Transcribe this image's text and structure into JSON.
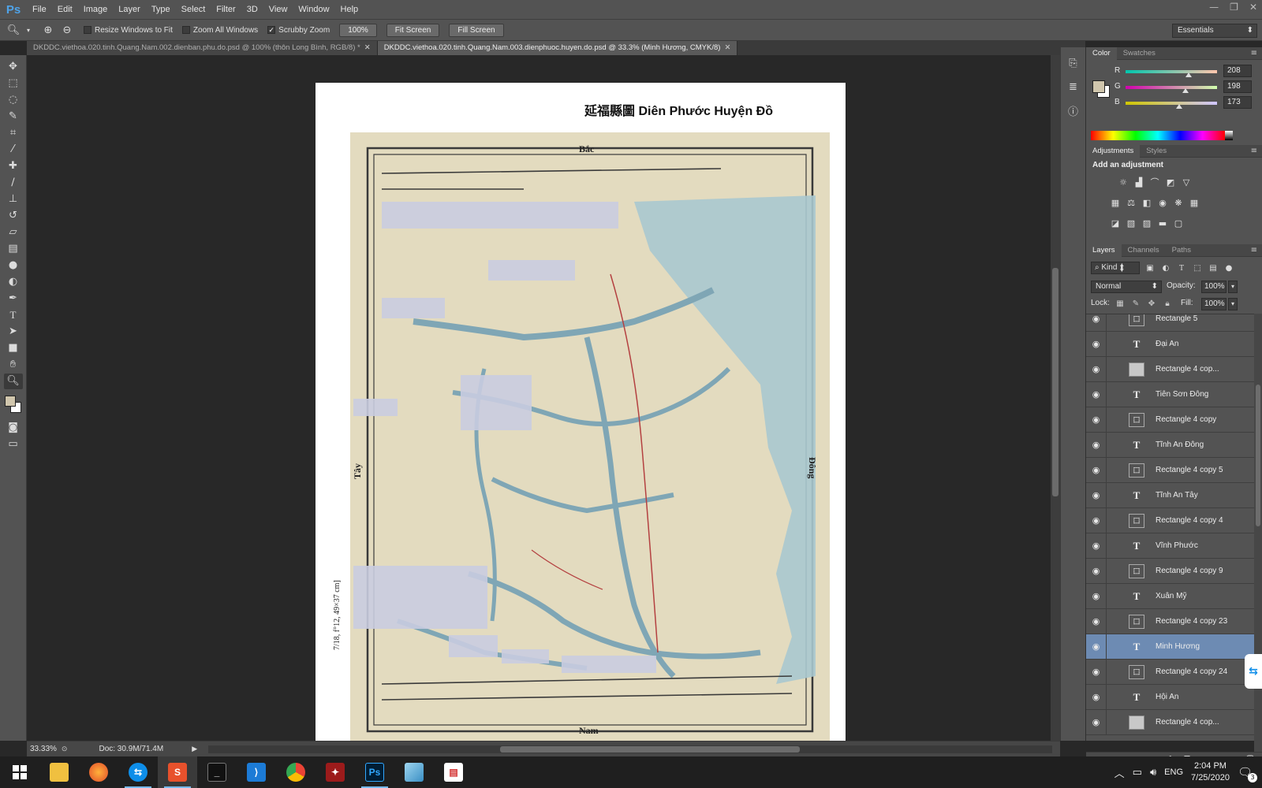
{
  "app": {
    "logo": "Ps",
    "menu": [
      "File",
      "Edit",
      "Image",
      "Layer",
      "Type",
      "Select",
      "Filter",
      "3D",
      "View",
      "Window",
      "Help"
    ],
    "window_controls": [
      "—",
      "❐",
      "✕"
    ]
  },
  "options_bar": {
    "tool_icon": "zoom-icon",
    "resize_windows_label": "Resize Windows to Fit",
    "resize_windows_checked": false,
    "zoom_all_label": "Zoom All Windows",
    "zoom_all_checked": false,
    "scrubby_label": "Scrubby Zoom",
    "scrubby_checked": true,
    "btn_100": "100%",
    "btn_fit": "Fit Screen",
    "btn_fill": "Fill Screen",
    "workspace": "Essentials"
  },
  "tabs": [
    {
      "label": "DKDDC.viethoa.020.tinh.Quang.Nam.002.dienban.phu.do.psd @ 100% (thôn Long Bình, RGB/8) *",
      "close": "✕",
      "active": false
    },
    {
      "label": "DKDDC.viethoa.020.tinh.Quang.Nam.003.dienphuoc.huyen.do.psd @ 33.3% (Minh Hương, CMYK/8)",
      "close": "✕",
      "active": true
    }
  ],
  "document": {
    "title": "延福縣圖  Diên Phước Huyện Đồ",
    "side_label": "7/18, f°12, 49×37 cm]",
    "map_labels": {
      "north": "Bắc",
      "south": "Nam",
      "west": "Tây",
      "east": "Đông"
    }
  },
  "color_panel": {
    "tabs": [
      "Color",
      "Swatches"
    ],
    "fg": "#d0c6ad",
    "r_label": "R",
    "r_value": "208",
    "g_label": "G",
    "g_value": "198",
    "b_label": "B",
    "b_value": "173"
  },
  "adjustments_panel": {
    "tabs": [
      "Adjustments",
      "Styles"
    ],
    "title": "Add an adjustment"
  },
  "layers_panel": {
    "tabs": [
      "Layers",
      "Channels",
      "Paths"
    ],
    "filter_kind": "Kind",
    "blend_mode": "Normal",
    "opacity_label": "Opacity:",
    "opacity_value": "100%",
    "lock_label": "Lock:",
    "fill_label": "Fill:",
    "fill_value": "100%",
    "layers": [
      {
        "name": "Rectangle 5",
        "kind": "shape",
        "selected": false
      },
      {
        "name": "Đại An",
        "kind": "text",
        "selected": false
      },
      {
        "name": "Rectangle 4 cop...",
        "kind": "smart",
        "selected": false
      },
      {
        "name": "Tiên Sơn Đông",
        "kind": "text",
        "selected": false
      },
      {
        "name": "Rectangle 4 copy",
        "kind": "shape",
        "selected": false
      },
      {
        "name": "Tĩnh An Đông",
        "kind": "text",
        "selected": false
      },
      {
        "name": "Rectangle 4 copy 5",
        "kind": "shape",
        "selected": false
      },
      {
        "name": "Tĩnh An Tây",
        "kind": "text",
        "selected": false
      },
      {
        "name": "Rectangle 4 copy 4",
        "kind": "shape",
        "selected": false
      },
      {
        "name": "Vĩnh Phước",
        "kind": "text",
        "selected": false
      },
      {
        "name": "Rectangle 4 copy 9",
        "kind": "shape",
        "selected": false
      },
      {
        "name": "Xuân Mỹ",
        "kind": "text",
        "selected": false
      },
      {
        "name": "Rectangle 4 copy 23",
        "kind": "shape",
        "selected": false
      },
      {
        "name": "Minh Hương",
        "kind": "text",
        "selected": true
      },
      {
        "name": "Rectangle 4 copy 24",
        "kind": "shape",
        "selected": false
      },
      {
        "name": "Hội An",
        "kind": "text",
        "selected": false
      },
      {
        "name": "Rectangle 4 cop...",
        "kind": "smart",
        "selected": false
      }
    ]
  },
  "status_bar": {
    "zoom": "33.33%",
    "doc": "Doc: 30.9M/71.4M"
  },
  "taskbar": {
    "lang": "ENG",
    "time": "2:04 PM",
    "date": "7/25/2020",
    "notification_count": "3"
  }
}
